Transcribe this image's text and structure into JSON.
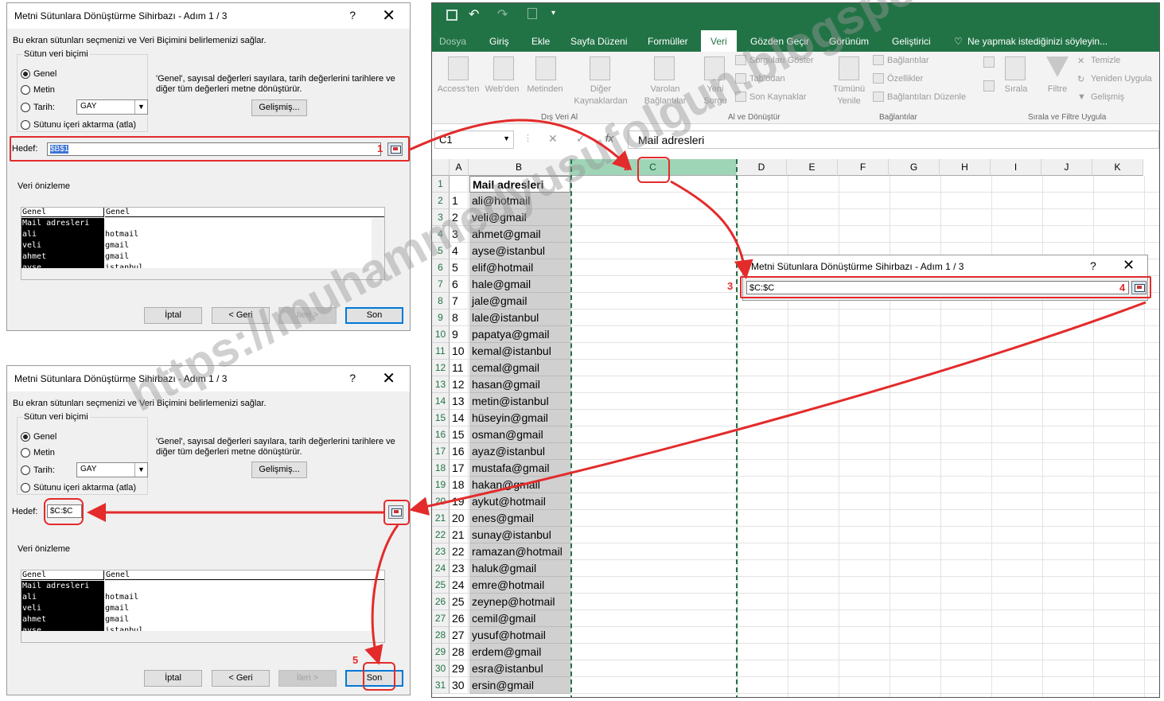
{
  "dialog": {
    "title": "Metni Sütunlara Dönüştürme Sihirbazı - Adım 1 / 3",
    "help": "?",
    "close": "✕",
    "intro": "Bu ekran sütunları seçmenizi ve Veri Biçimini belirlemenizi  sağlar.",
    "group_label": "Sütun veri biçimi",
    "opt_general": "Genel",
    "opt_text": "Metin",
    "opt_date": "Tarih:",
    "date_fmt": "GAY",
    "opt_skip": "Sütunu içeri aktarma (atla)",
    "desc": "'Genel', sayısal değerleri sayılara, tarih değerlerini tarihlere ve diğer tüm değerleri metne dönüştürür.",
    "advanced": "Gelişmiş...",
    "dest_label": "Hedef:",
    "preview_label": "Veri önizleme",
    "pv_h1": "Genel",
    "pv_h2": "Genel",
    "pv_c1": [
      "Mail adresleri",
      "ali",
      "veli",
      "ahmet",
      "ayse"
    ],
    "pv_c2": [
      "",
      "hotmail",
      "gmail",
      "gmail",
      "istanbul"
    ],
    "cancel": "İptal",
    "back": "< Geri",
    "next": "İleri >",
    "finish": "Son"
  },
  "dialog1": {
    "dest_value": "$B$1"
  },
  "dialog2": {
    "dest_value": "$C:$C"
  },
  "mini": {
    "title": "Metni Sütunlara Dönüştürme Sihirbazı - Adım 1 / 3",
    "help": "?",
    "close": "✕",
    "value": "$C:$C"
  },
  "steps": [
    "1",
    "2",
    "3",
    "4",
    "5"
  ],
  "excel": {
    "tabs": [
      "Dosya",
      "Giriş",
      "Ekle",
      "Sayfa Düzeni",
      "Formüller",
      "Veri",
      "Gözden Geçir",
      "Görünüm",
      "Geliştirici",
      "Ne yapmak istediğinizi söyleyin..."
    ],
    "active_tab": "Veri",
    "ribbon": {
      "access": "Access'ten",
      "web": "Web'den",
      "metin": "Metinden",
      "diger": "Diğer Kaynaklardan",
      "varolan": "Varolan Bağlantılar",
      "yeni": "Yeni Sorgu",
      "sorgu_goster": "Sorguları Göster",
      "tablodan": "Tablodan",
      "son_kaynak": "Son Kaynaklar",
      "tumunu": "Tümünü Yenile",
      "baglantilar": "Bağlantılar",
      "ozellikler": "Özellikler",
      "bag_duzenle": "Bağlantıları Düzenle",
      "sirala": "Sırala",
      "filtre": "Filtre",
      "temizle": "Temizle",
      "yeniden": "Yeniden Uygula",
      "gelismis": "Gelişmiş",
      "g1": "Dış Veri Al",
      "g2": "Al ve Dönüştür",
      "g3": "Bağlantılar",
      "g4": "Sırala ve Filtre Uygula"
    },
    "namebox": "C1",
    "formula": "Mail adresleri",
    "fx": "fx",
    "columns": [
      "A",
      "B",
      "C",
      "D",
      "E",
      "F",
      "G",
      "H",
      "I",
      "J",
      "K"
    ],
    "rows": [
      "1",
      "2",
      "3",
      "4",
      "5",
      "6",
      "7",
      "8",
      "9",
      "10",
      "11",
      "12",
      "13",
      "14",
      "15",
      "16",
      "17",
      "18",
      "19",
      "20",
      "21",
      "22",
      "23",
      "24",
      "25",
      "26",
      "27",
      "28",
      "29",
      "30",
      "31"
    ],
    "colA": [
      "",
      "1",
      "2",
      "3",
      "4",
      "5",
      "6",
      "7",
      "8",
      "9",
      "10",
      "11",
      "12",
      "13",
      "14",
      "15",
      "16",
      "17",
      "18",
      "19",
      "20",
      "21",
      "22",
      "23",
      "24",
      "25",
      "26",
      "27",
      "28",
      "29",
      "30"
    ],
    "colB": [
      "Mail adresleri",
      "ali@hotmail",
      "veli@gmail",
      "ahmet@gmail",
      "ayse@istanbul",
      "elif@hotmail",
      "hale@gmail",
      "jale@gmail",
      "lale@istanbul",
      "papatya@gmail",
      "kemal@istanbul",
      "cemal@gmail",
      "hasan@gmail",
      "metin@istanbul",
      "hüseyin@gmail",
      "osman@gmail",
      "ayaz@istanbul",
      "mustafa@gmail",
      "hakan@gmail",
      "aykut@hotmail",
      "enes@gmail",
      "sunay@istanbul",
      "ramazan@hotmail",
      "haluk@gmail",
      "emre@hotmail",
      "zeynep@hotmail",
      "cemil@gmail",
      "yusuf@hotmail",
      "erdem@gmail",
      "esra@istanbul",
      "ersin@gmail"
    ]
  },
  "watermark": "https://muhammedyusufolgun.blogspot.com",
  "colors": {
    "excel_green": "#217346",
    "annotation_red": "#e32b2b"
  }
}
